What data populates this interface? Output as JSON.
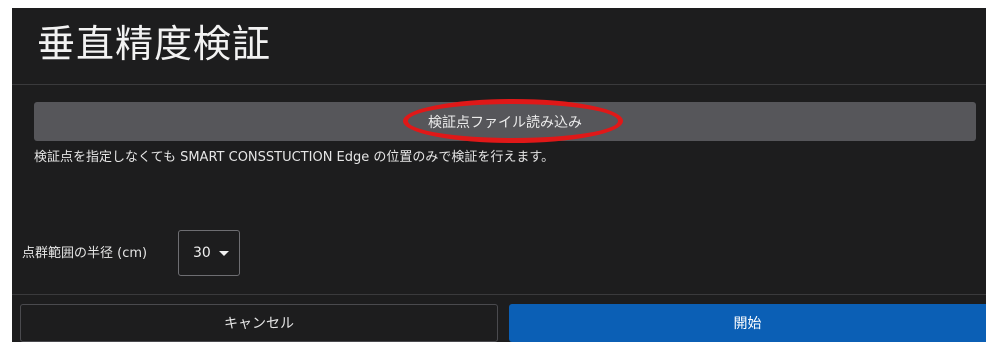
{
  "dialog": {
    "title": "垂直精度検証",
    "load_button_label": "検証点ファイル読み込み",
    "hint_text": "検証点を指定しなくても SMART CONSSTUCTION Edge の位置のみで検証を行えます。",
    "radius_label": "点群範囲の半径 (cm)",
    "radius_value": "30",
    "cancel_label": "キャンセル",
    "start_label": "開始"
  },
  "colors": {
    "background": "#1d1d1e",
    "button_gray": "#56565a",
    "primary_blue": "#0b5fb5",
    "highlight_red": "#e01818"
  },
  "icons": {
    "dropdown": "caret-down-icon"
  }
}
